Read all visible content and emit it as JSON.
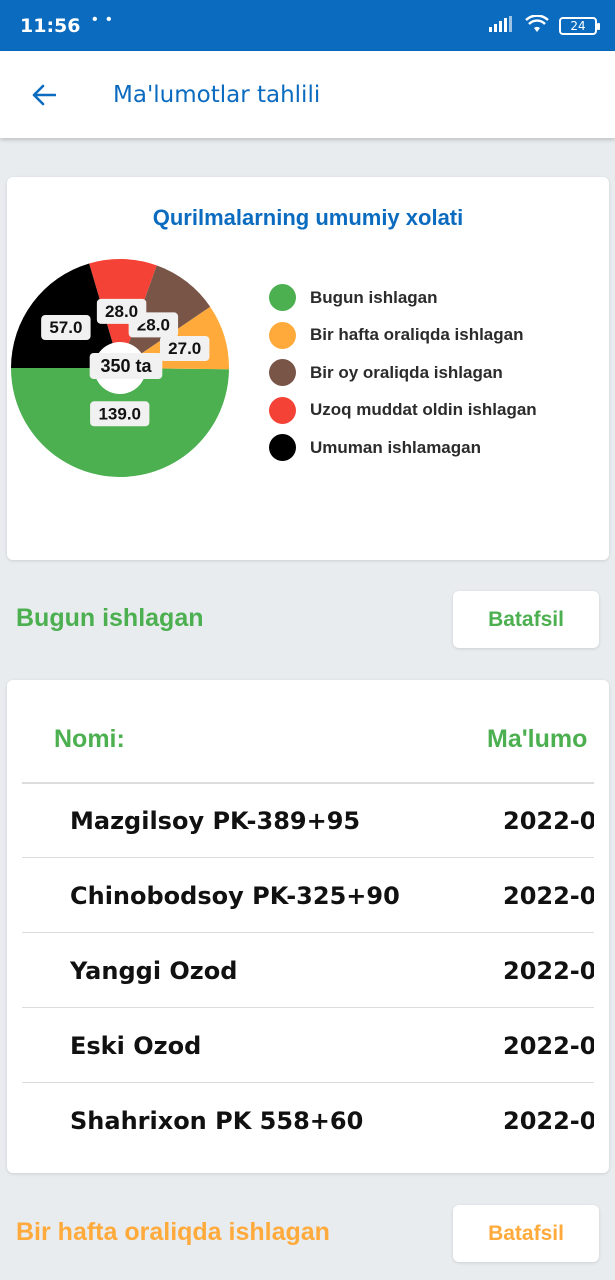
{
  "status_bar": {
    "time": "11:56",
    "dots": "• •",
    "battery": "24"
  },
  "header": {
    "title": "Ma'lumotlar tahlili"
  },
  "chart_card": {
    "title": "Qurilmalarning umumiy xolati",
    "center_label": "350 ta",
    "legend": [
      {
        "label": "Bugun ishlagan",
        "color": "#4CAF50"
      },
      {
        "label": "Bir hafta oraliqda ishlagan",
        "color": "#FFAA3B"
      },
      {
        "label": "Bir oy oraliqda ishlagan",
        "color": "#795548"
      },
      {
        "label": "Uzoq muddat oldin ishlagan",
        "color": "#F44336"
      },
      {
        "label": "Umuman ishlamagan",
        "color": "#000000"
      }
    ]
  },
  "chart_data": {
    "type": "pie",
    "total_label": "350 ta",
    "slices": [
      {
        "name": "Bugun ishlagan",
        "value": 139.0,
        "label": "139.0",
        "color": "#4CAF50"
      },
      {
        "name": "Bir hafta oraliqda ishlagan",
        "value": 27.0,
        "label": "27.0",
        "color": "#FFAA3B"
      },
      {
        "name": "Bir oy oraliqda ishlagan",
        "value": 28.0,
        "label": "28.0",
        "color": "#795548"
      },
      {
        "name": "Uzoq muddat oldin ishlagan",
        "value": 28.0,
        "label": "28.0",
        "color": "#F44336"
      },
      {
        "name": "Umuman ishlamagan",
        "value": 57.0,
        "label": "57.0",
        "color": "#000000"
      }
    ]
  },
  "section_today": {
    "title": "Bugun ishlagan",
    "button": "Batafsil",
    "color": "#4CAF50"
  },
  "table": {
    "headers": {
      "name": "Nomi:",
      "info": "Ma'lumo"
    },
    "rows": [
      {
        "name": "Mazgilsoy PK-389+95",
        "date": "2022-0"
      },
      {
        "name": "Chinobodsoy PK-325+90",
        "date": "2022-0"
      },
      {
        "name": "Yanggi Ozod",
        "date": "2022-0"
      },
      {
        "name": "Eski Ozod",
        "date": "2022-0"
      },
      {
        "name": "Shahrixon PK 558+60",
        "date": "2022-0"
      }
    ]
  },
  "section_week": {
    "title": "Bir hafta oraliqda ishlagan",
    "button": "Batafsil",
    "color": "#FFAA3B"
  }
}
